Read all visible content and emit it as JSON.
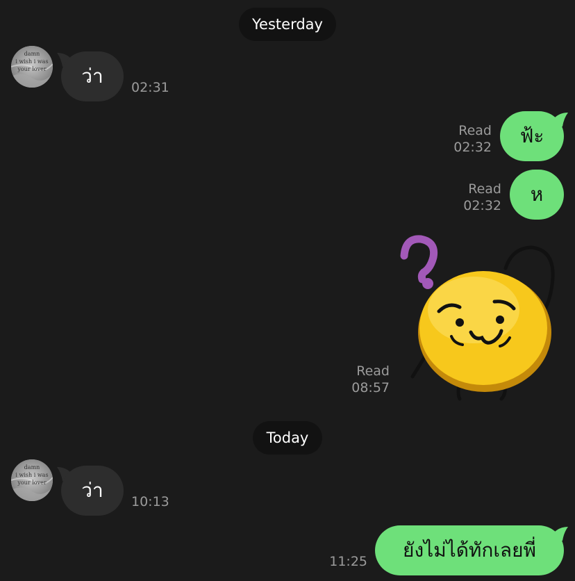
{
  "chat": {
    "date_yesterday": "Yesterday",
    "date_today": "Today",
    "avatar_text": [
      "damn",
      "i wish i was",
      "your lover"
    ],
    "messages": [
      {
        "text": "ว่า",
        "time": "02:31"
      },
      {
        "text": "ฟ้ะ",
        "status": "Read",
        "time": "02:32"
      },
      {
        "text": "ห",
        "status": "Read",
        "time": "02:32"
      },
      {
        "sticker": "confused-yellow-cat-sticker",
        "status": "Read",
        "time": "08:57"
      },
      {
        "text": "ว่า",
        "time": "10:13"
      },
      {
        "text": "ยังไม่ได้ทักเลยพี่",
        "time": "11:25"
      }
    ]
  },
  "colors": {
    "background": "#1b1b1b",
    "incoming_bubble": "#2d2d2d",
    "outgoing_bubble": "#6ee07a",
    "date_pill": "#121212",
    "meta_text": "#9b9b9b",
    "sticker_face": "#f7c81c",
    "question_mark": "#a259b8"
  }
}
